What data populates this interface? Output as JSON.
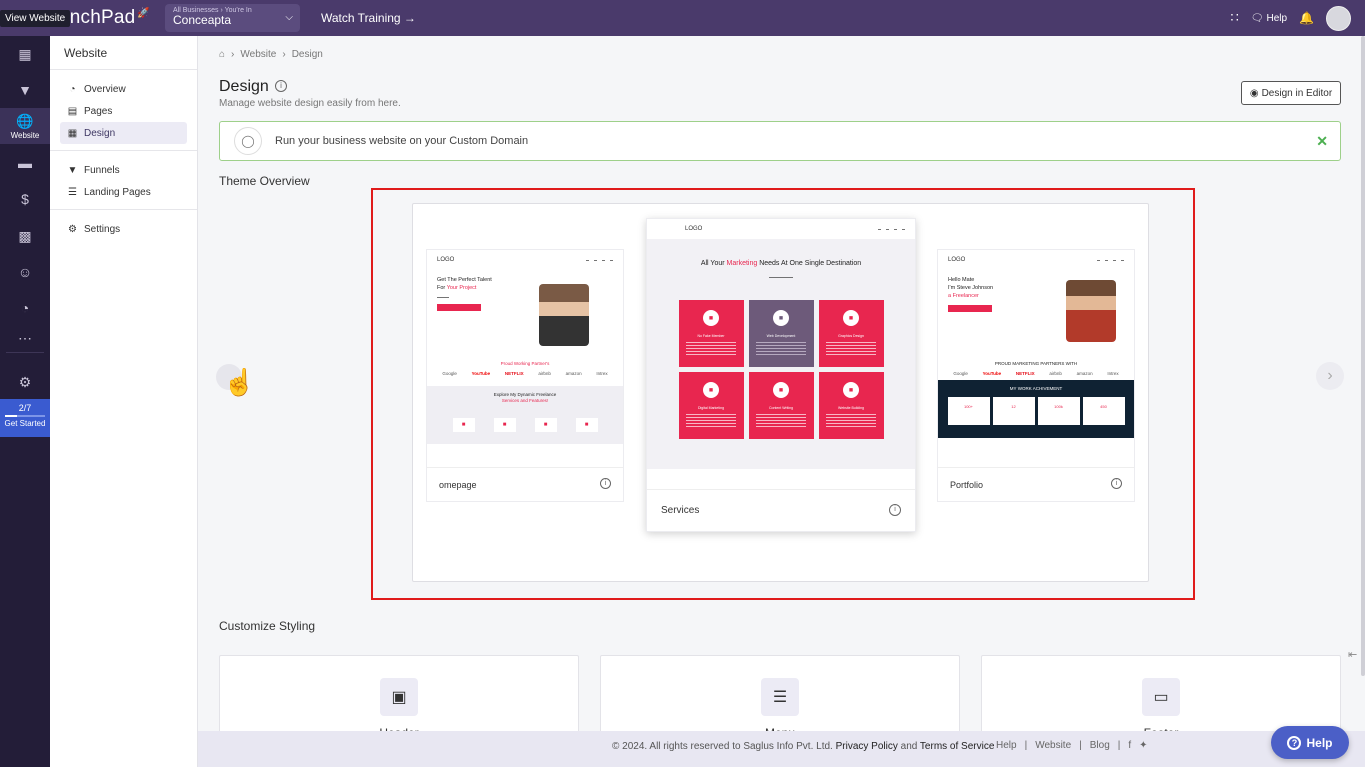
{
  "topbar": {
    "brand": "unchPad",
    "tooltip": "View Website",
    "business_small": "All Businesses › You're In",
    "business_name": "Conceapta",
    "watch_training": "Watch Training →",
    "help": "Help"
  },
  "rail": {
    "active_label": "Website",
    "progress": "2/7",
    "progress_fraction": 0.29,
    "get_started": "Get Started"
  },
  "sidebar": {
    "title": "Website",
    "group1": [
      {
        "label": "Overview",
        "icon": "gauge-icon"
      },
      {
        "label": "Pages",
        "icon": "pages-icon"
      },
      {
        "label": "Design",
        "icon": "grid-icon",
        "active": true
      }
    ],
    "group2": [
      {
        "label": "Funnels",
        "icon": "funnel-icon"
      },
      {
        "label": "Landing Pages",
        "icon": "list-icon"
      }
    ],
    "group3": [
      {
        "label": "Settings",
        "icon": "gear-icon"
      }
    ]
  },
  "main": {
    "breadcrumb": {
      "home": "home-icon",
      "website": "Website",
      "design": "Design"
    },
    "title": "Design",
    "subtitle": "Manage website design easily from here.",
    "design_editor": "Design in Editor",
    "banner": "Run your business website on your Custom Domain",
    "theme_overview": "Theme Overview",
    "customize_styling": "Customize Styling"
  },
  "themes": {
    "left": {
      "name": "omepage",
      "logo": "LOGO",
      "hero_line1": "Get The Perfect Talent",
      "hero_line2_pre": "For ",
      "hero_line2_em": "Your Project",
      "partners": "Proud Working Partner's",
      "logos": [
        "Google",
        "YouTube",
        "NETFLIX",
        "airbnb",
        "amazon",
        "Intrex"
      ],
      "explore_line1": "Explore My Dynamic Freelance",
      "explore_line2": "Services and Features!"
    },
    "center": {
      "name": "Services",
      "logo": "LOGO",
      "heading_pre": "All Your ",
      "heading_em": "Marketing",
      "heading_post": " Needs At One Single Destination",
      "services": [
        "No Fake Member",
        "Web Development",
        "Graphics Design",
        "Digital Marketing",
        "Content Writing",
        "Website Building"
      ]
    },
    "right": {
      "name": "Portfolio",
      "logo": "LOGO",
      "hello": "Hello Mate",
      "name_line": "I'm Steve Johnson",
      "role": "a Freelancer",
      "partners": "PROUD MARKETING PARTNERS WITH",
      "logos": [
        "Google",
        "YouTube",
        "NETFLIX",
        "airbnb",
        "amazon",
        "Intrex"
      ],
      "achievement": "MY WORK ACHIVEMENT",
      "stats": [
        "100+",
        "12",
        "100k",
        "450"
      ]
    }
  },
  "styling_cards": [
    {
      "label": "Header",
      "icon": "window-icon"
    },
    {
      "label": "Menu",
      "icon": "menu-icon"
    },
    {
      "label": "Footer",
      "icon": "monitor-icon"
    }
  ],
  "footer": {
    "copyright_pre": "©  2024. All rights reserved to Saglus Info Pvt. Ltd. ",
    "privacy": "Privacy Policy",
    "and": " and ",
    "terms": "Terms of Service",
    "links": [
      "Help",
      "Website",
      "Blog"
    ]
  },
  "help_button": "Help"
}
